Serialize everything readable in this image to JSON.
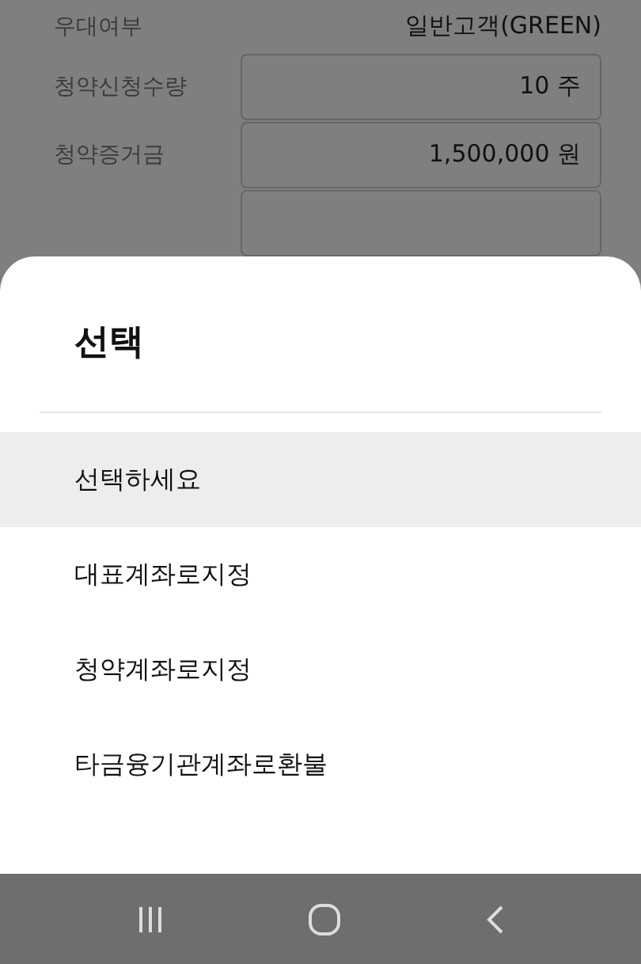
{
  "form": {
    "rows": [
      {
        "kind": "text",
        "label": "우대여부",
        "value": "일반고객(GREEN)"
      },
      {
        "kind": "field",
        "label": "청약신청수량",
        "value": "10 주"
      },
      {
        "kind": "field",
        "label": "청약증거금",
        "value": "1,500,000 원"
      },
      {
        "kind": "field",
        "label": "",
        "value": ""
      }
    ]
  },
  "sheet": {
    "title": "선택",
    "options": [
      {
        "label": "선택하세요",
        "selected": true
      },
      {
        "label": "대표계좌로지정",
        "selected": false
      },
      {
        "label": "청약계좌로지정",
        "selected": false
      },
      {
        "label": "타금융기관계좌로환불",
        "selected": false
      }
    ]
  }
}
